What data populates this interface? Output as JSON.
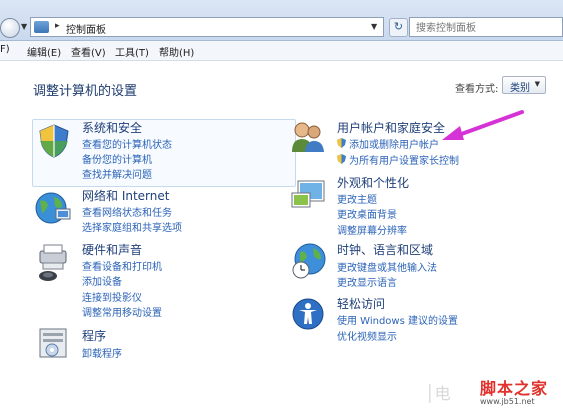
{
  "address_bar": {
    "path": "控制面板",
    "search_placeholder": "搜索控制面板"
  },
  "menu": {
    "items": [
      "F)",
      "编辑(E)",
      "查看(V)",
      "工具(T)",
      "帮助(H)"
    ]
  },
  "page": {
    "title": "调整计算机的设置",
    "view_label": "查看方式:",
    "view_value": "类别"
  },
  "categories": [
    {
      "icon": "system-security-icon",
      "title": "系统和安全",
      "links": [
        "查看您的计算机状态",
        "备份您的计算机",
        "查找并解决问题"
      ]
    },
    {
      "icon": "network-internet-icon",
      "title": "网络和 Internet",
      "links": [
        "查看网络状态和任务",
        "选择家庭组和共享选项"
      ]
    },
    {
      "icon": "hardware-sound-icon",
      "title": "硬件和声音",
      "links": [
        "查看设备和打印机",
        "添加设备",
        "连接到投影仪",
        "调整常用移动设置"
      ]
    },
    {
      "icon": "programs-icon",
      "title": "程序",
      "links": [
        "卸载程序"
      ]
    },
    {
      "icon": "user-accounts-icon",
      "title": "用户帐户和家庭安全",
      "links": [
        "添加或删除用户帐户",
        "为所有用户设置家长控制"
      ]
    },
    {
      "icon": "appearance-icon",
      "title": "外观和个性化",
      "links": [
        "更改主题",
        "更改桌面背景",
        "调整屏幕分辨率"
      ]
    },
    {
      "icon": "clock-region-icon",
      "title": "时钟、语言和区域",
      "links": [
        "更改键盘或其他输入法",
        "更改显示语言"
      ]
    },
    {
      "icon": "ease-of-access-icon",
      "title": "轻松访问",
      "links": [
        "使用 Windows 建议的设置",
        "优化视频显示"
      ]
    }
  ],
  "watermark": {
    "logo": "脚本之家",
    "url": "www.jb51.net"
  },
  "colors": {
    "link": "#2b63b8",
    "title": "#1f3f7a",
    "arrow": "#d633d6"
  }
}
